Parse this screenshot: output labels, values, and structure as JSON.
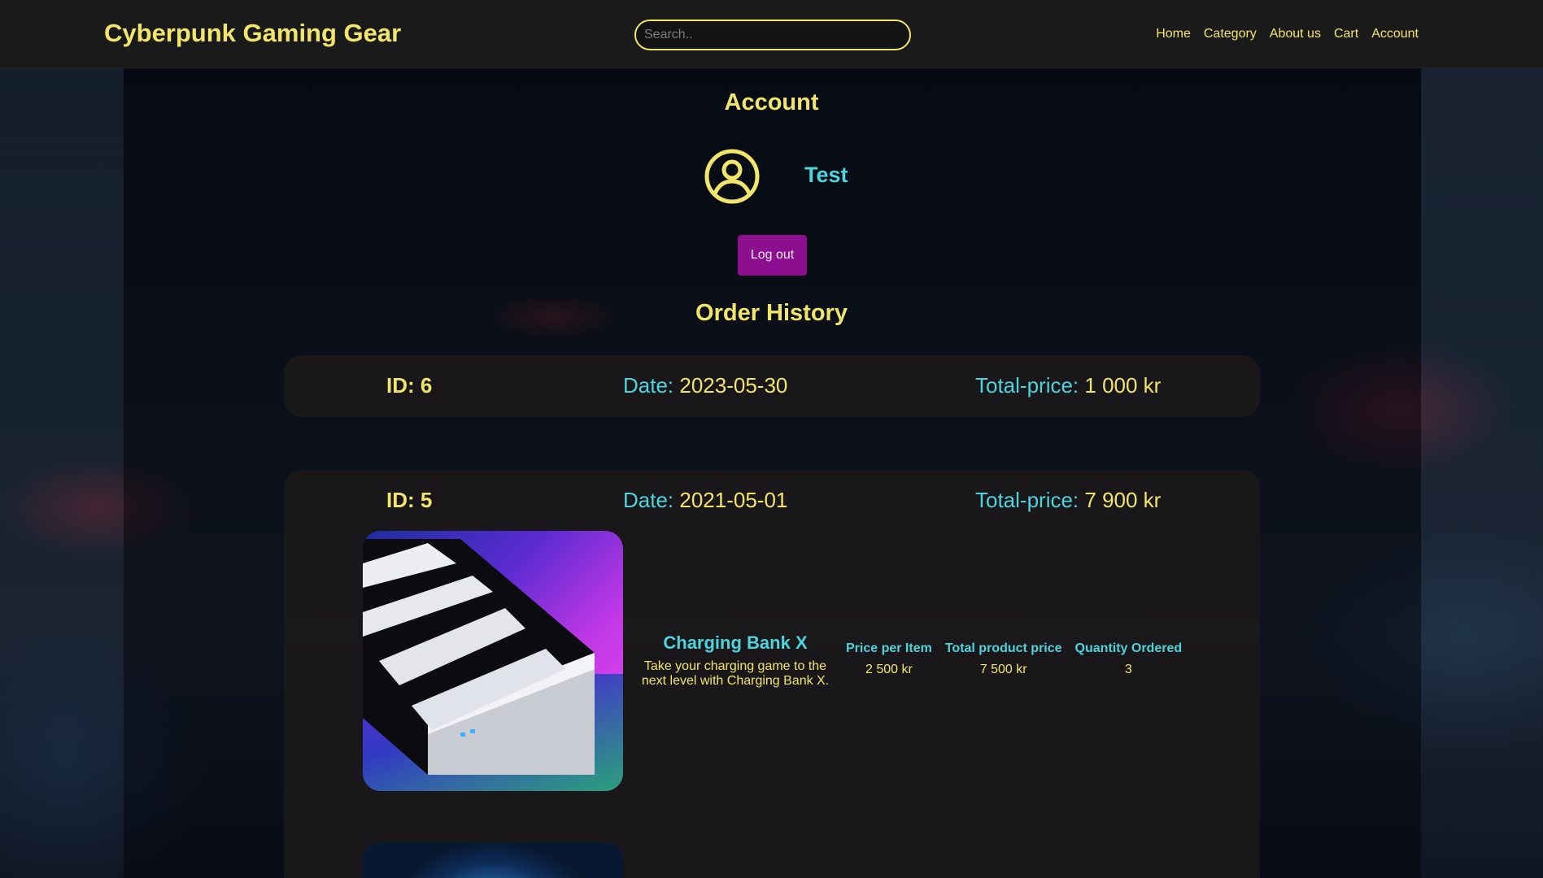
{
  "header": {
    "brand": "Cyberpunk Gaming Gear",
    "search_placeholder": "Search..",
    "nav": [
      "Home",
      "Category",
      "About us",
      "Cart",
      "Account"
    ]
  },
  "account": {
    "title": "Account",
    "username": "Test",
    "logout_label": "Log out"
  },
  "order_history": {
    "title": "Order History",
    "orders": [
      {
        "id_label": "ID: 6",
        "date_label": "Date:",
        "date": "2023-05-30",
        "total_label": "Total-price:",
        "total": "1 000 kr"
      },
      {
        "id_label": "ID: 5",
        "date_label": "Date:",
        "date": "2021-05-01",
        "total_label": "Total-price:",
        "total": "7 900 kr",
        "products": [
          {
            "name": "Charging Bank X",
            "description": "Take your charging game to the next level with Charging Bank X.",
            "columns": [
              "Price per Item",
              "Total product price",
              "Quantity Ordered"
            ],
            "values": [
              "2 500 kr",
              "7 500 kr",
              "3"
            ]
          }
        ]
      }
    ]
  },
  "colors": {
    "accent_yellow": "#f2e56b",
    "accent_cyan": "#4fd3dc",
    "logout_purple": "#8b0f8e",
    "header_bg": "#1a1a1a"
  }
}
